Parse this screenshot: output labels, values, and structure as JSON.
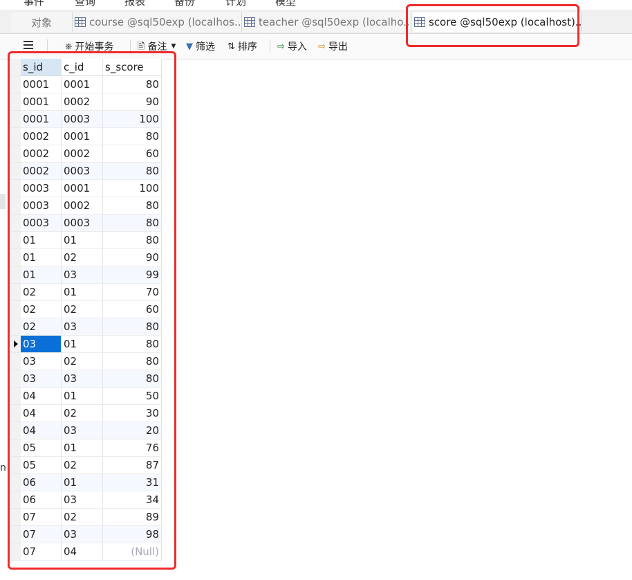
{
  "menu": [
    "事件",
    "查询",
    "报表",
    "备份",
    "计划",
    "模型"
  ],
  "tabs": [
    {
      "label": "对象",
      "active": false
    },
    {
      "label": "course @sql50exp (localhos...",
      "active": false
    },
    {
      "label": "teacher @sql50exp (localho...",
      "active": false
    },
    {
      "label": "score @sql50exp (localhost)...",
      "active": true
    }
  ],
  "toolbar": {
    "begin_transaction": "开始事务",
    "memo": "备注",
    "filter": "筛选",
    "sort": "排序",
    "import": "导入",
    "export": "导出"
  },
  "gutter_char": "n",
  "table": {
    "columns": [
      "s_id",
      "c_id",
      "s_score"
    ],
    "null_text": "(Null)",
    "selected_row": 15,
    "rows": [
      [
        "0001",
        "0001",
        "80"
      ],
      [
        "0001",
        "0002",
        "90"
      ],
      [
        "0001",
        "0003",
        "100"
      ],
      [
        "0002",
        "0001",
        "80"
      ],
      [
        "0002",
        "0002",
        "60"
      ],
      [
        "0002",
        "0003",
        "80"
      ],
      [
        "0003",
        "0001",
        "100"
      ],
      [
        "0003",
        "0002",
        "80"
      ],
      [
        "0003",
        "0003",
        "80"
      ],
      [
        "01",
        "01",
        "80"
      ],
      [
        "01",
        "02",
        "90"
      ],
      [
        "01",
        "03",
        "99"
      ],
      [
        "02",
        "01",
        "70"
      ],
      [
        "02",
        "02",
        "60"
      ],
      [
        "02",
        "03",
        "80"
      ],
      [
        "03",
        "01",
        "80"
      ],
      [
        "03",
        "02",
        "80"
      ],
      [
        "03",
        "03",
        "80"
      ],
      [
        "04",
        "01",
        "50"
      ],
      [
        "04",
        "02",
        "30"
      ],
      [
        "04",
        "03",
        "20"
      ],
      [
        "05",
        "01",
        "76"
      ],
      [
        "05",
        "02",
        "87"
      ],
      [
        "06",
        "01",
        "31"
      ],
      [
        "06",
        "03",
        "34"
      ],
      [
        "07",
        "02",
        "89"
      ],
      [
        "07",
        "03",
        "98"
      ],
      [
        "07",
        "04",
        null
      ]
    ]
  },
  "colors": {
    "highlight": "#ee2b2b",
    "selection": "#0a6fd6"
  }
}
